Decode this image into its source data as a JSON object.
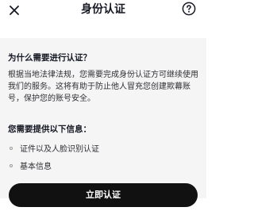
{
  "header": {
    "title": "身份认证",
    "close_icon": "close-icon",
    "help_icon": "help-icon"
  },
  "intro": {
    "question": "为什么需要进行认证？",
    "description": "根据当地法律法规，您需要完成身份认证方可继续使用我们的服务。这将有助于防止他人冒充您创建欺幕账号，保护您的账号安全。"
  },
  "requirements": {
    "title": "您需要提供以下信息：",
    "items": [
      "证件以及人脸识别认证",
      "基本信息"
    ]
  },
  "action": {
    "button_label": "立即认证"
  },
  "colors": {
    "text": "#161823",
    "card_background": "#f5f5f6",
    "button_background": "#111111",
    "button_text": "#ffffff"
  }
}
